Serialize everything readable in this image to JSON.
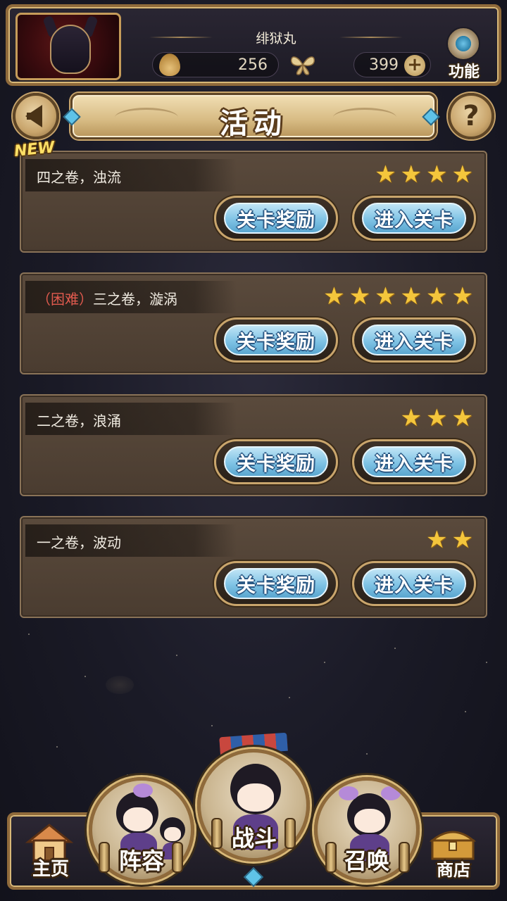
{
  "header": {
    "player_name": "绯狱丸",
    "currency_primary": "256",
    "currency_secondary": "399",
    "function_label": "功能"
  },
  "page": {
    "title": "活动",
    "new_badge": "NEW"
  },
  "stages": [
    {
      "title": "四之卷，浊流",
      "difficulty_tag": "",
      "stars": 4,
      "reward_label": "关卡奖励",
      "enter_label": "进入关卡"
    },
    {
      "title": "三之卷，漩涡",
      "difficulty_tag": "（困难）",
      "stars": 6,
      "reward_label": "关卡奖励",
      "enter_label": "进入关卡"
    },
    {
      "title": "二之卷，浪涌",
      "difficulty_tag": "",
      "stars": 3,
      "reward_label": "关卡奖励",
      "enter_label": "进入关卡"
    },
    {
      "title": "一之卷，波动",
      "difficulty_tag": "",
      "stars": 2,
      "reward_label": "关卡奖励",
      "enter_label": "进入关卡"
    }
  ],
  "nav": {
    "home": "主页",
    "lineup": "阵容",
    "battle": "战斗",
    "summon": "召唤",
    "shop": "商店"
  },
  "colors": {
    "star": "#f4c63c",
    "button_blue": "#7fc3e5",
    "hard_red": "#e05a4e",
    "frame_gold": "#c9a56c"
  }
}
